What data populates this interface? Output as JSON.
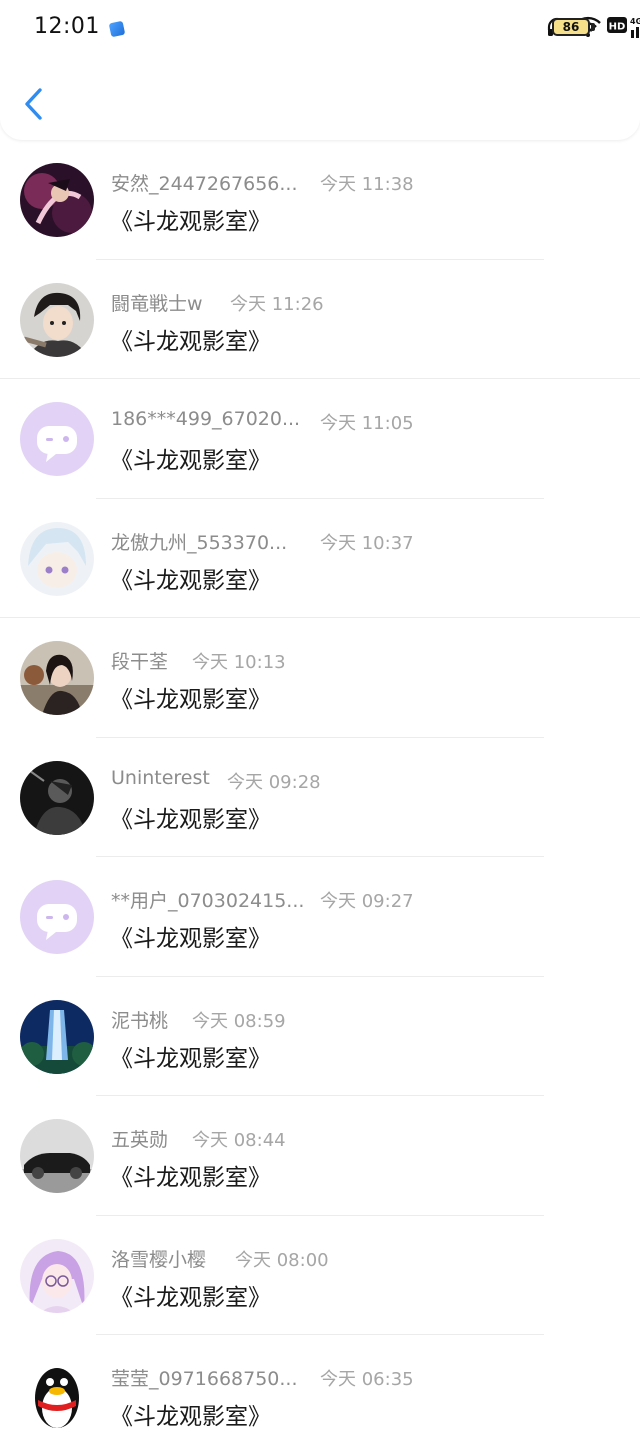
{
  "status_bar": {
    "time": "12:01",
    "battery": "86",
    "icons": [
      "app-notification-icon",
      "headphones-icon",
      "wifi-icon",
      "hd-icon",
      "signal-4g-icon",
      "battery-icon"
    ]
  },
  "header": {
    "back_icon": "chevron-left-icon",
    "accent": "#2f8cf0"
  },
  "messages": [
    {
      "name": "安然_2447267656...",
      "time": "今天 11:38",
      "text": "《斗龙观影室》",
      "avatar": "anime-avatar-dark"
    },
    {
      "name": "闘竜戦士w",
      "time": "今天 11:26",
      "text": "《斗龙观影室》",
      "avatar": "anime-avatar-boy"
    },
    {
      "name": "186***499_67020...",
      "time": "今天 11:05",
      "text": "《斗龙观影室》",
      "avatar": "default-chat-avatar"
    },
    {
      "name": "龙傲九州_553370...",
      "time": "今天 10:37",
      "text": "《斗龙观影室》",
      "avatar": "anime-avatar-white-hair"
    },
    {
      "name": "段干荃",
      "time": "今天 10:13",
      "text": "《斗龙观影室》",
      "avatar": "photo-avatar-woman"
    },
    {
      "name": "Uninterest",
      "time": "今天 09:28",
      "text": "《斗龙观影室》",
      "avatar": "photo-avatar-dark"
    },
    {
      "name": "**用户_070302415...",
      "time": "今天 09:27",
      "text": "《斗龙观影室》",
      "avatar": "default-chat-avatar"
    },
    {
      "name": "泥书桃",
      "time": "今天 08:59",
      "text": "《斗龙观影室》",
      "avatar": "photo-avatar-waterfall"
    },
    {
      "name": "五英勋",
      "time": "今天 08:44",
      "text": "《斗龙观影室》",
      "avatar": "photo-avatar-car"
    },
    {
      "name": "洛雪樱小樱",
      "time": "今天 08:00",
      "text": "《斗龙观影室》",
      "avatar": "anime-avatar-pink-hair"
    },
    {
      "name": "莹莹_0971668750...",
      "time": "今天 06:35",
      "text": "《斗龙观影室》",
      "avatar": "qq-penguin-avatar"
    }
  ]
}
